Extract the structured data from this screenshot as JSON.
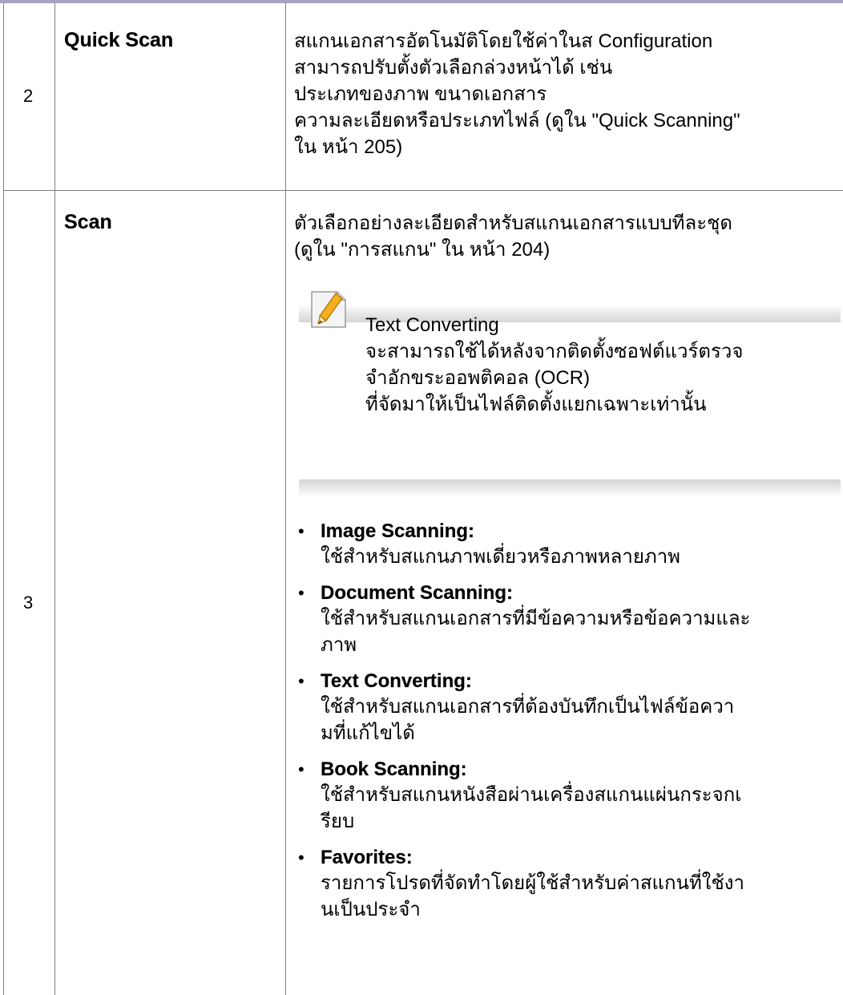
{
  "rows": [
    {
      "number": "2",
      "name": "Quick Scan",
      "description_lines": [
        "สแกนเอกสารอัตโนมัติโดยใช้ค่าในส Configuration",
        "สามารถปรับตั้งตัวเลือกล่วงหน้าได้ เช่น",
        "ประเภทของภาพ ขนาดเอกสาร",
        "ความละเอียดหรือประเภทไฟล์ (ดูใน \"Quick Scanning\"",
        "ใน หน้า 205)"
      ]
    },
    {
      "number": "3",
      "name": "Scan",
      "description_lines": [
        "ตัวเลือกอย่างละเอียดสำหรับสแกนเอกสารแบบทีละชุด",
        "(ดูใน \"การสแกน\"  ใน หน้า 204)"
      ],
      "note": {
        "icon": "note-pencil-icon",
        "title": "Text Converting",
        "lines": [
          "จะสามารถใช้ได้หลังจากติดตั้งซอฟต์แวร์ตรวจ",
          "จำอักขระออพติคอล (OCR)",
          "ที่จัดมาให้เป็นไฟล์ติดตั้งแยกเฉพาะเท่านั้น"
        ]
      },
      "bullets": [
        {
          "title": "Image Scanning:",
          "lines": [
            "ใช้สำหรับสแกนภาพเดี่ยวหรือภาพหลายภาพ"
          ]
        },
        {
          "title": "Document Scanning:",
          "lines": [
            "ใช้สำหรับสแกนเอกสารที่มีข้อความหรือข้อความและ",
            "ภาพ"
          ]
        },
        {
          "title": "Text Converting:",
          "lines": [
            "ใช้สำหรับสแกนเอกสารที่ต้องบันทึกเป็นไฟล์ข้อควา",
            "มที่แก้ไขได้"
          ]
        },
        {
          "title": "Book Scanning:",
          "lines": [
            "ใช้สำหรับสแกนหนังสือผ่านเครื่องสแกนแผ่นกระจกเ",
            "รียบ"
          ]
        },
        {
          "title": "Favorites:",
          "lines": [
            "รายการโปรดที่จัดทำโดยผู้ใช้สำหรับค่าสแกนที่ใช้งา",
            "นเป็นประจำ"
          ]
        }
      ]
    }
  ],
  "colors": {
    "header_rule": "#a7a0c0",
    "grid": "#7f7f7f",
    "note_shade": "#d4d4d4"
  }
}
